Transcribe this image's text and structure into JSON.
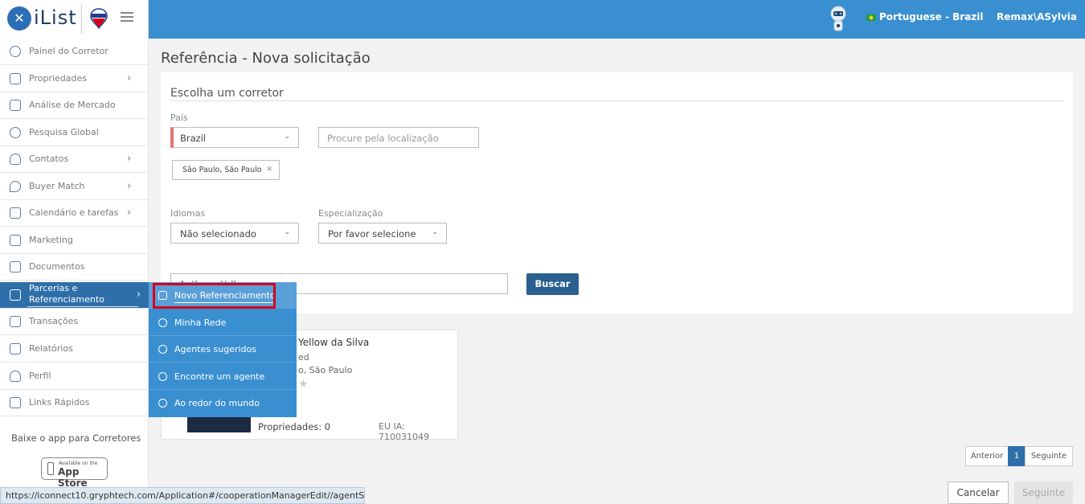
{
  "app": {
    "logo_text": "iList"
  },
  "header": {
    "language": "Portuguese - Brazil",
    "user": "Remax\\ASylvia"
  },
  "sidebar": {
    "items": [
      {
        "label": "Painel do Corretor",
        "has_arrow": false
      },
      {
        "label": "Propriedades",
        "has_arrow": true
      },
      {
        "label": "Análise de Mercado",
        "has_arrow": false
      },
      {
        "label": "Pesquisa Global",
        "has_arrow": false
      },
      {
        "label": "Contatos",
        "has_arrow": true
      },
      {
        "label": "Buyer Match",
        "has_arrow": true
      },
      {
        "label": "Calendário e tarefas",
        "has_arrow": true
      },
      {
        "label": "Marketing",
        "has_arrow": false
      },
      {
        "label": "Documentos",
        "has_arrow": false
      },
      {
        "label_line1": "Parcerias e",
        "label_line2": "Referenciamento",
        "has_arrow": true,
        "active": true
      },
      {
        "label": "Transações",
        "has_arrow": false
      },
      {
        "label": "Relatórios",
        "has_arrow": false
      },
      {
        "label": "Perfil",
        "has_arrow": false
      },
      {
        "label": "Links Rápidos",
        "has_arrow": false
      }
    ],
    "app_text": "Baixe o app para Corretores",
    "app_store_small": "Available on the",
    "app_store_big": "App Store"
  },
  "submenu": {
    "items": [
      {
        "label": "Novo Referenciamento"
      },
      {
        "label": "Minha Rede"
      },
      {
        "label": "Agentes sugeridos"
      },
      {
        "label": "Encontre um agente"
      },
      {
        "label": "Ao redor do mundo"
      }
    ]
  },
  "main": {
    "page_title": "Referência - Nova solicitação",
    "section_title": "Escolha um corretor",
    "country_label": "País",
    "country_value": "Brazil",
    "location_placeholder": "Procure pela localização",
    "location_tag": "São Paulo, São Paulo",
    "languages_label": "Idiomas",
    "languages_value": "Não selecionado",
    "specialization_label": "Especialização",
    "specialization_value": "Por favor selecione",
    "search_value": "Anthony Yellow",
    "search_button": "Buscar"
  },
  "result": {
    "name": "Yellow da Silva",
    "status": "ed",
    "location": "o, São Paulo",
    "star": "★",
    "properties": "Propriedades: 0",
    "id": "EU IA: 710031049"
  },
  "pagination": {
    "prev": "Anterior",
    "current": "1",
    "next": "Seguinte"
  },
  "footer": {
    "cancel": "Cancelar",
    "next": "Seguinte"
  },
  "statusbar": {
    "url": "https://iconnect10.gryphtech.com/Application#/cooperationManagerEdit//agentS..."
  }
}
